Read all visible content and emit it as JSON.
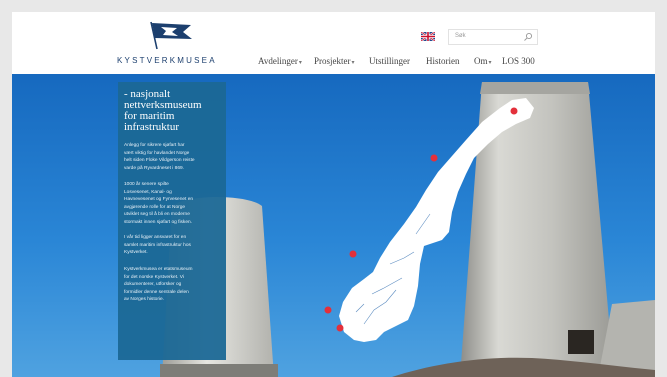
{
  "brand": {
    "name": "KYSTVERKMUSEA",
    "flag_icon": "flag-logo-icon"
  },
  "header": {
    "language_flag_icon": "uk-flag-icon",
    "search": {
      "placeholder": "Søk",
      "icon": "search-icon"
    }
  },
  "nav": {
    "items": [
      {
        "label": "Avdelinger",
        "has_dropdown": true
      },
      {
        "label": "Prosjekter",
        "has_dropdown": true
      },
      {
        "label": "Utstillinger",
        "has_dropdown": false
      },
      {
        "label": "Historien",
        "has_dropdown": false
      },
      {
        "label": "Om",
        "has_dropdown": true
      },
      {
        "label": "LOS 300",
        "has_dropdown": false
      }
    ],
    "caret": "▾"
  },
  "panel": {
    "title_lines": [
      "- nasjonalt",
      "nettverksmuseum",
      "for maritim",
      "infrastruktur"
    ],
    "paragraphs": [
      [
        "Anlegg for sikrere sjøfart har",
        "vært viktig for havlandet Norge",
        "helt siden Floke Vildgerson reiste",
        "varde på Ryvardneset i 869."
      ],
      [
        "1000 år senere spilte",
        "Losvesenet, Kanal- og",
        "Havnevesenet og Fyrvesenet en",
        "avgjørende rolle for at Norge",
        "utviklet seg til å bli en moderne",
        "stormakt innen sjøfart og fisken."
      ],
      [
        "I vår tid ligger ansvaret for en",
        "samlet maritim infrastruktur hos",
        "Kystverket."
      ],
      [
        "Kystverkmusea er etatsmuseum",
        "for det norske Kystverket. Vi",
        "dokumenterer, utforsker og",
        "formidler denne sentrale delen",
        "av Norges historie."
      ]
    ]
  },
  "colors": {
    "brand_blue": "#1c3f6e",
    "panel_blue": "#1b6896",
    "sky_blue": "#1976c8",
    "marker_red": "#e3303b"
  }
}
